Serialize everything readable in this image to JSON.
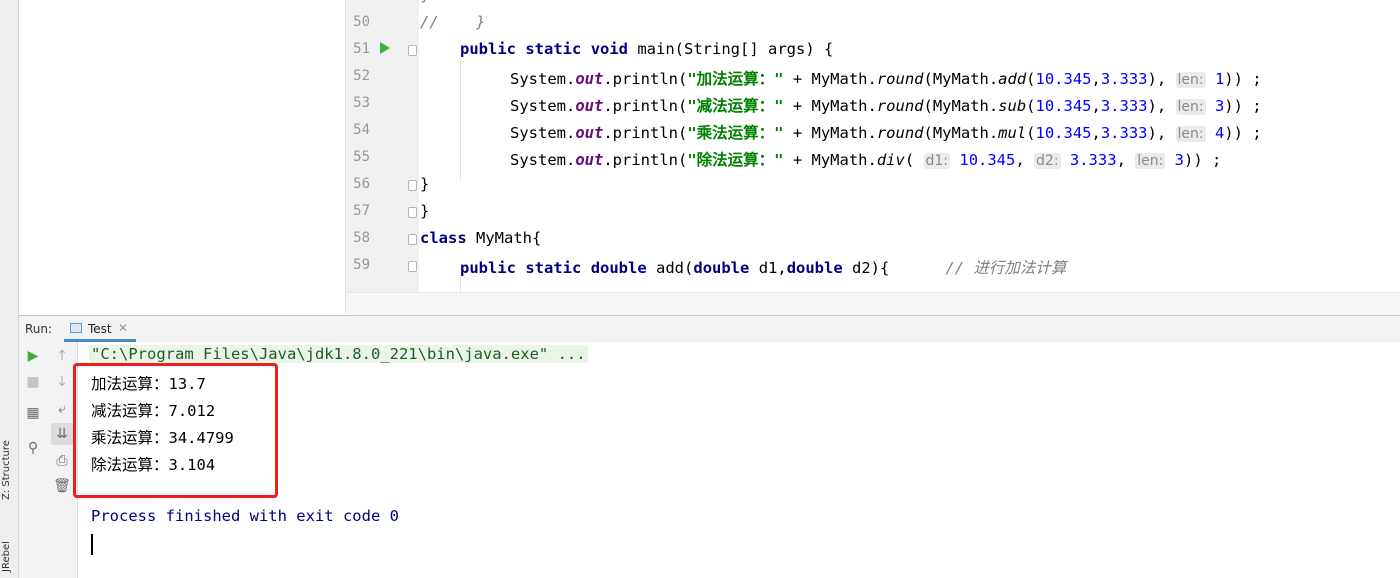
{
  "side_strip": {
    "structure_label": "Z: Structure",
    "jrebel_label": "JRebel"
  },
  "editor": {
    "lines": [
      {
        "num": "50",
        "text": "//    }"
      },
      {
        "num": "51"
      },
      {
        "num": "52"
      },
      {
        "num": "53"
      },
      {
        "num": "54"
      },
      {
        "num": "55"
      },
      {
        "num": "56"
      },
      {
        "num": "57"
      },
      {
        "num": "58"
      },
      {
        "num": "59"
      }
    ],
    "code": {
      "l51": {
        "kw1": "public",
        "kw2": "static",
        "kw3": "void",
        "rest": " main(String[] args) {"
      },
      "l52": {
        "pre": "System.",
        "out": "out",
        "call": ".println(",
        "str": "\"加法运算：\"",
        "mid": " + MyMath.",
        "round": "round",
        "p1": "(MyMath.",
        "fn": "add",
        "p2": "(",
        "a": "10.345",
        "comma": ",",
        "b": "3.333",
        "p3": "), ",
        "hint": "len:",
        "len": "1",
        "end": ")) ;"
      },
      "l53": {
        "str": "\"减法运算：\"",
        "fn": "sub",
        "len": "3"
      },
      "l54": {
        "str": "\"乘法运算：\"",
        "fn": "mul",
        "len": "4"
      },
      "l55": {
        "str": "\"除法运算：\"",
        "fn": "div",
        "hint_d1": "d1:",
        "a": "10.345",
        "hint_d2": "d2:",
        "b": "3.333",
        "hint_len": "len:",
        "len": "3",
        "end": ")) ;"
      },
      "l56": "}",
      "l57": "}",
      "l58": {
        "kw": "class",
        "rest": " MyMath{"
      },
      "l59": {
        "kw1": "public",
        "kw2": "static",
        "kw3": "double",
        "mid1": " add(",
        "kw4": "double",
        "mid2": " d1,",
        "kw5": "double",
        "mid3": " d2){",
        "comment": "// 进行加法计算"
      }
    }
  },
  "run": {
    "label": "Run:",
    "tab": "Test",
    "command": "\"C:\\Program Files\\Java\\jdk1.8.0_221\\bin\\java.exe\" ...",
    "output": [
      {
        "label": "加法运算：",
        "value": "13.7"
      },
      {
        "label": "减法运算：",
        "value": "7.012"
      },
      {
        "label": "乘法运算：",
        "value": "34.4799"
      },
      {
        "label": "除法运算：",
        "value": "3.104"
      }
    ],
    "finished": "Process finished with exit code 0"
  },
  "colors": {
    "keyword": "#000080",
    "string": "#008000",
    "number": "#0000ff",
    "field": "#660e7a",
    "highlight_box": "#ef1c1c"
  }
}
